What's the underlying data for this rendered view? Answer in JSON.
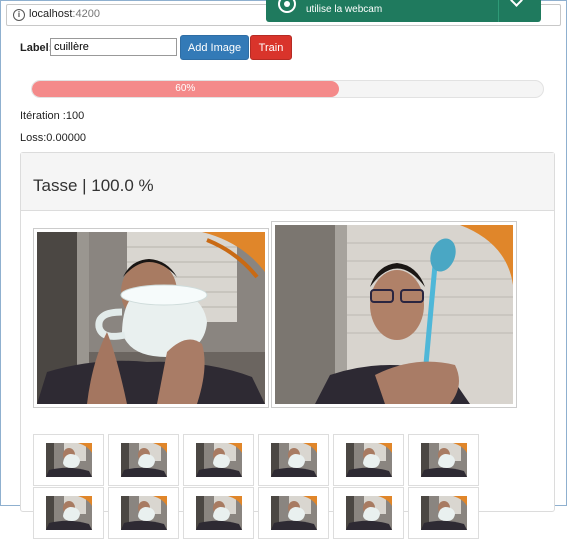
{
  "browser": {
    "host": "localhost",
    "port": ":4200"
  },
  "notification": {
    "message": "utilise la webcam"
  },
  "form": {
    "label": "Label:",
    "input_value": "cuillère",
    "add_button": "Add Image",
    "train_button": "Train"
  },
  "progress": {
    "percent": 60,
    "label": "60%"
  },
  "stats": {
    "iteration": "Itération :100",
    "loss": "Loss:0.00000"
  },
  "result": {
    "title": "Tasse | 100.0 %"
  },
  "thumbnails": {
    "count": 12
  },
  "colors": {
    "progress_fill": "#f48a8a",
    "primary": "#337ab7",
    "danger": "#d9342b",
    "notification": "#1f7a5e"
  }
}
